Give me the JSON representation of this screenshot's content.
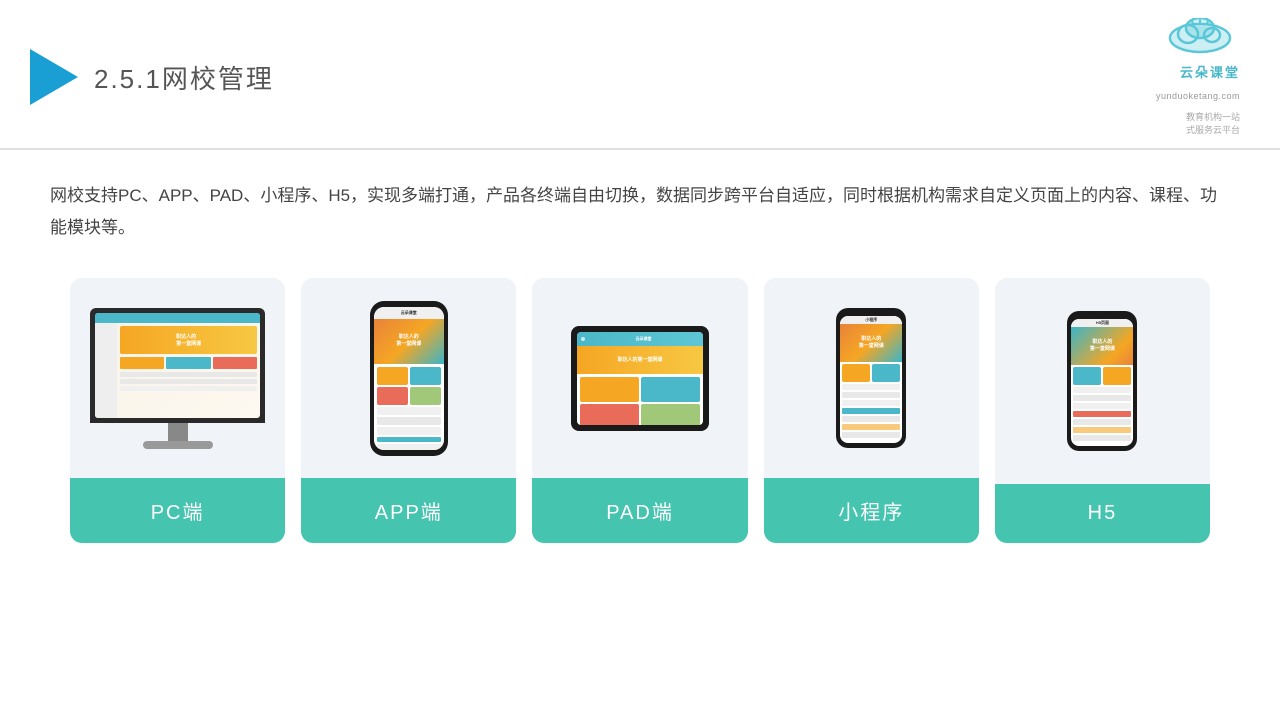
{
  "header": {
    "section_number": "2.5.1",
    "title": "网校管理",
    "brand": {
      "name": "云朵课堂",
      "domain": "yunduoketang.com",
      "slogan": "教育机构一站\n式服务云平台"
    }
  },
  "description": "网校支持PC、APP、PAD、小程序、H5，实现多端打通，产品各终端自由切换，数据同步跨平台自适应，同时根据机构需求自定义页面上的内容、课程、功能模块等。",
  "cards": [
    {
      "id": "pc",
      "label": "PC端"
    },
    {
      "id": "app",
      "label": "APP端"
    },
    {
      "id": "pad",
      "label": "PAD端"
    },
    {
      "id": "mini-program",
      "label": "小程序"
    },
    {
      "id": "h5",
      "label": "H5"
    }
  ],
  "label_bg_color": "#45c4b0"
}
